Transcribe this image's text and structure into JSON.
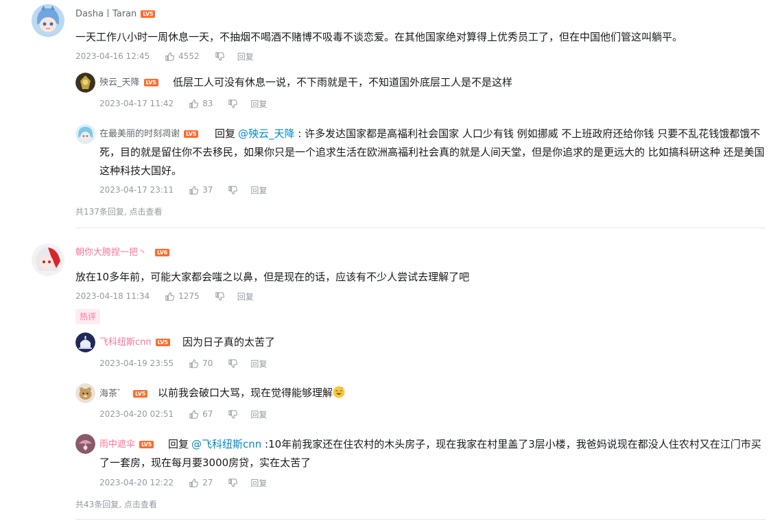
{
  "comments": [
    {
      "user": "Dasha丨Taran",
      "lv": "LV5",
      "text": "一天工作八小时一周休息一天，不抽烟不喝酒不赌博不吸毒不谈恋爱。在其他国家绝对算得上优秀员工了，但在中国他们管这叫躺平。",
      "time": "2023-04-16 12:45",
      "likes": "4552",
      "reply_label": "回复",
      "replies": [
        {
          "user": "殃云_天降",
          "lv": "LV5",
          "text": "低层工人可没有休息一说，不下雨就是干，不知道国外底层工人是不是这样",
          "time": "2023-04-17 11:42",
          "likes": "83",
          "reply_label": "回复"
        },
        {
          "user": "在最美丽的时刻凋谢",
          "lv": "LV5",
          "reply_word": "回复",
          "at": "@殃云_天降",
          "text": " : 许多发达国家都是高福利社会国家 人口少有钱 例如挪威  不上班政府还给你钱 只要不乱花钱饿都饿不死，目的就是留住你不去移民，如果你只是一个追求生活在欧洲高福利社会真的就是人间天堂，但是你追求的是更远大的 比如搞科研这种 还是美国这种科技大国好。",
          "time": "2023-04-17 23:11",
          "likes": "37",
          "reply_label": "回复"
        }
      ],
      "more": "共137条回复, 点击查看"
    },
    {
      "user": "朝你大胯捏一把丶",
      "lv": "LV6",
      "text": "放在10多年前，可能大家都会嗤之以鼻，但是现在的话，应该有不少人尝试去理解了吧",
      "time": "2023-04-18 11:34",
      "likes": "1275",
      "reply_label": "回复",
      "hot_tag": "热评",
      "replies": [
        {
          "user": "飞科纽斯cnn",
          "lv": "LV5",
          "text": "因为日子真的太苦了",
          "time": "2023-04-19 23:55",
          "likes": "70",
          "reply_label": "回复"
        },
        {
          "user": "海茶゛",
          "lv": "LV5",
          "text": "以前我会破口大骂，现在觉得能够理解",
          "time": "2023-04-20 02:51",
          "likes": "67",
          "reply_label": "回复"
        },
        {
          "user": "雨中遮伞",
          "lv": "LV5",
          "reply_word": "回复",
          "at": "@飞科纽斯cnn",
          "text": " :10年前我家还在住农村的木头房子，现在我家在村里盖了3层小楼，我爸妈说现在都没人住农村又在江门市买了一套房，现在每月要3000房贷，实在太苦了",
          "time": "2023-04-20 12:22",
          "likes": "27",
          "reply_label": "回复"
        }
      ],
      "more": "共43条回复, 点击查看"
    }
  ],
  "colors": {
    "username_pink": "#fb7299",
    "username_gray": "#61666d",
    "at_link": "#008ac5",
    "meta": "#9499a0",
    "level_badge": "#ff6b2c"
  }
}
